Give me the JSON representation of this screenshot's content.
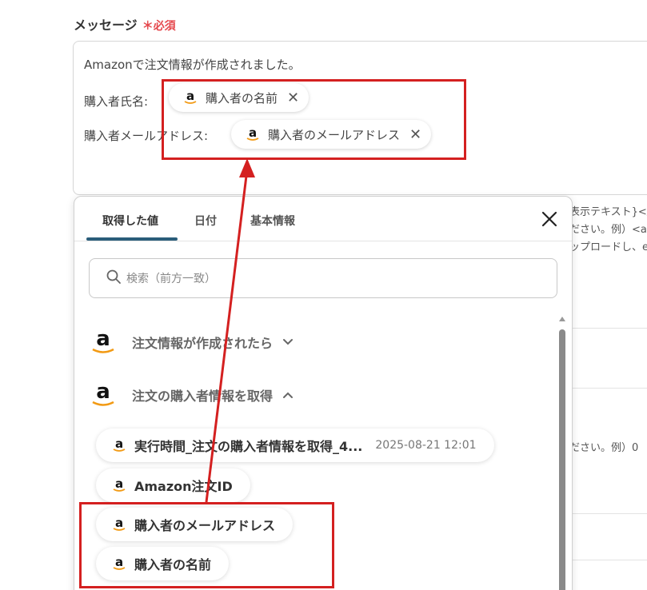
{
  "field": {
    "label": "メッセージ",
    "required_mark": "＊",
    "required_text": "必須"
  },
  "editor": {
    "line1": "Amazonで注文情報が作成されました。",
    "line2_label": "購入者氏名:",
    "line3_label": "購入者メールアドレス:",
    "token_name": "購入者の名前",
    "token_email": "購入者のメールアドレス"
  },
  "side_text": {
    "t1": "表示テキスト}</",
    "t2": "ださい。例）<at i",
    "t3": "ップロードし、e",
    "t4": "ださい。例）0"
  },
  "panel": {
    "tabs": [
      {
        "label": "取得した値",
        "active": true
      },
      {
        "label": "日付",
        "active": false
      },
      {
        "label": "基本情報",
        "active": false
      }
    ],
    "search_placeholder": "検索（前方一致）",
    "groups": [
      {
        "title": "注文情報が作成されたら",
        "expanded": false
      },
      {
        "title": "注文の購入者情報を取得",
        "expanded": true
      }
    ],
    "items": [
      {
        "label": "実行時間_注文の購入者情報を取得_4...",
        "meta": "2025-08-21 12:01"
      },
      {
        "label": "Amazon注文ID"
      },
      {
        "label": "購入者のメールアドレス"
      },
      {
        "label": "購入者の名前"
      }
    ]
  },
  "icons": {
    "brand": "amazon-icon",
    "close": "close-icon",
    "search": "search-icon",
    "expand": "chevron-down-icon",
    "collapse": "chevron-up-icon"
  },
  "colors": {
    "required": "#e5484d",
    "highlight": "#d42020",
    "tab_underline": "#2a5d7a",
    "amazon_smile": "#f29a14"
  }
}
